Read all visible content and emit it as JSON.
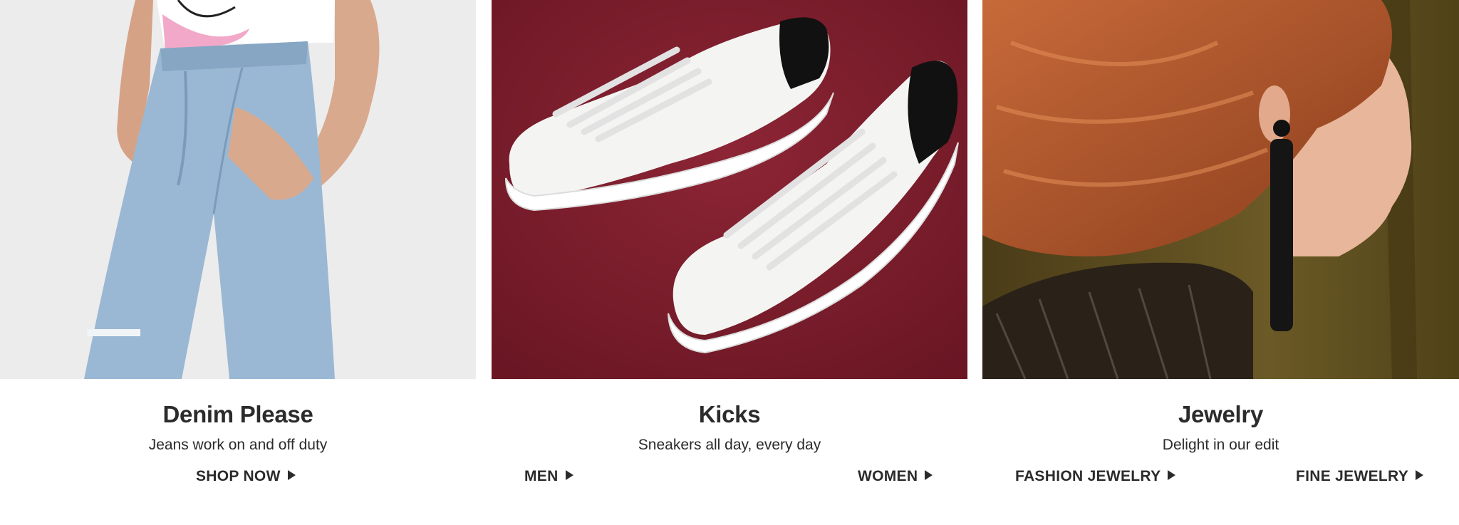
{
  "tiles": [
    {
      "title": "Denim Please",
      "subtitle": "Jeans work on and off duty",
      "links": [
        {
          "label": "SHOP NOW"
        }
      ],
      "image": "denim-model-photo"
    },
    {
      "title": "Kicks",
      "subtitle": "Sneakers all day, every day",
      "links": [
        {
          "label": "MEN"
        },
        {
          "label": "WOMEN"
        }
      ],
      "image": "white-sneakers-photo"
    },
    {
      "title": "Jewelry",
      "subtitle": "Delight in our edit",
      "links": [
        {
          "label": "FASHION JEWELRY"
        },
        {
          "label": "FINE JEWELRY"
        }
      ],
      "image": "earring-model-photo"
    }
  ],
  "colors": {
    "text": "#2b2b2b",
    "background": "#ffffff",
    "kicks_backdrop": "#7d1e2c",
    "jewelry_backdrop": "#5a4a1e"
  }
}
